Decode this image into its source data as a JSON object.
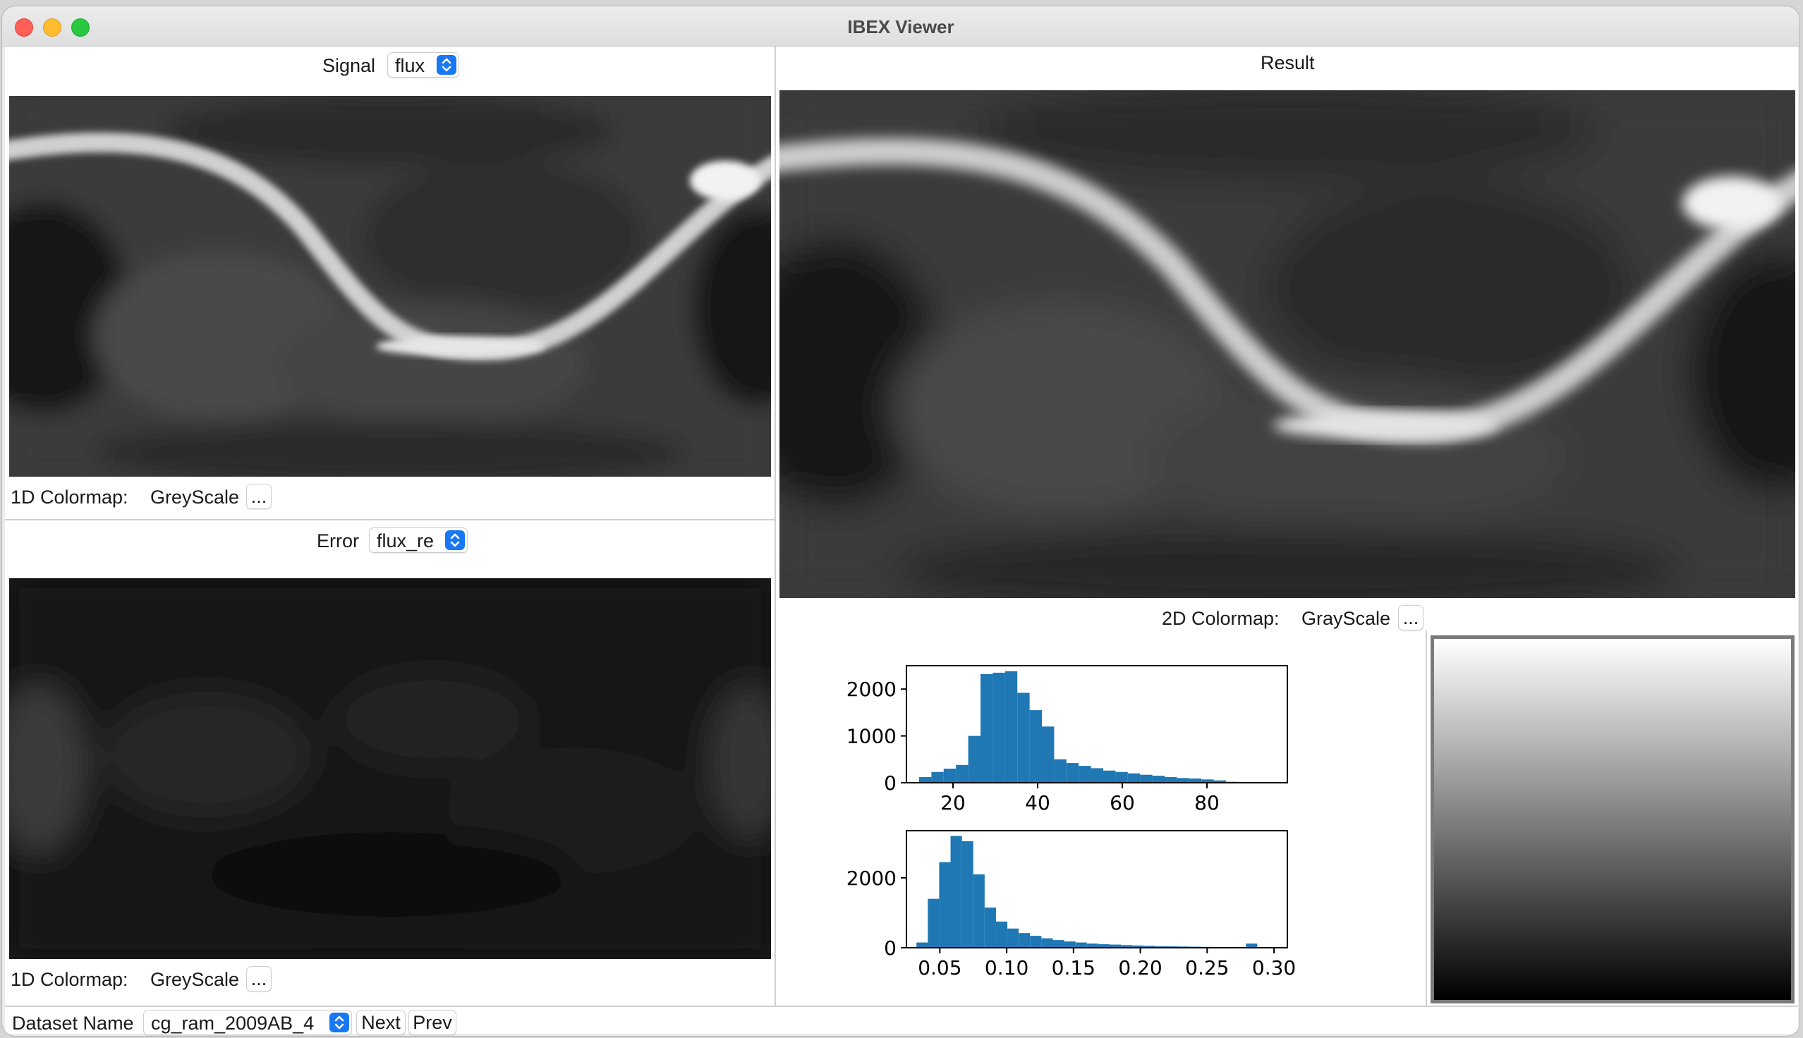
{
  "window": {
    "title": "IBEX Viewer"
  },
  "signal": {
    "label": "Signal",
    "selected": "flux",
    "colormap_label": "1D Colormap:",
    "colormap_value": "GreyScale",
    "more_label": "..."
  },
  "error": {
    "label": "Error",
    "selected": "flux_re",
    "colormap_label": "1D Colormap:",
    "colormap_value": "GreyScale",
    "more_label": "..."
  },
  "result": {
    "label": "Result",
    "colormap_label": "2D Colormap:",
    "colormap_value": "GrayScale",
    "more_label": "..."
  },
  "footer": {
    "dataset_label": "Dataset Name",
    "dataset_value": "cg_ram_2009AB_4",
    "next_label": "Next",
    "prev_label": "Prev"
  },
  "icons": {
    "select_arrows": "chevron-up-down-icon"
  },
  "colors": {
    "accent": "#1877f2",
    "bar": "#1f77b4"
  },
  "chart_data": [
    {
      "type": "bar",
      "title": "",
      "xlabel": "",
      "ylabel": "",
      "xlim": [
        9,
        99
      ],
      "ylim": [
        0,
        2500
      ],
      "xticks": [
        20,
        40,
        60,
        80
      ],
      "yticks": [
        0,
        1000,
        2000
      ],
      "bin_width": 2.9,
      "bin_starts": [
        12.0,
        14.9,
        17.8,
        20.7,
        23.6,
        26.5,
        29.4,
        32.3,
        35.2,
        38.1,
        41.0,
        43.9,
        46.8,
        49.7,
        52.6,
        55.5,
        58.4,
        61.3,
        64.2,
        67.1,
        70.0,
        72.9,
        75.8,
        78.7,
        81.6,
        84.5
      ],
      "values": [
        120,
        230,
        300,
        380,
        1000,
        2320,
        2350,
        2380,
        1920,
        1550,
        1200,
        500,
        420,
        360,
        310,
        260,
        230,
        200,
        170,
        150,
        120,
        100,
        90,
        70,
        50,
        20
      ]
    },
    {
      "type": "bar",
      "title": "",
      "xlabel": "",
      "ylabel": "",
      "xlim": [
        0.025,
        0.31
      ],
      "ylim": [
        0,
        3350
      ],
      "xticks": [
        0.05,
        0.1,
        0.15,
        0.2,
        0.25,
        0.3
      ],
      "xtick_labels": [
        "0.05",
        "0.10",
        "0.15",
        "0.20",
        "0.25",
        "0.30"
      ],
      "yticks": [
        0,
        2000
      ],
      "bin_width": 0.0085,
      "bin_starts": [
        0.0325,
        0.041,
        0.0495,
        0.058,
        0.0665,
        0.075,
        0.0835,
        0.092,
        0.1005,
        0.109,
        0.1175,
        0.126,
        0.1345,
        0.143,
        0.1515,
        0.16,
        0.1685,
        0.177,
        0.1855,
        0.194,
        0.2025,
        0.211,
        0.2195,
        0.228,
        0.2365,
        0.245,
        0.2535,
        0.262,
        0.2705,
        0.279
      ],
      "values": [
        150,
        1400,
        2450,
        3200,
        3050,
        2100,
        1150,
        750,
        550,
        420,
        340,
        270,
        220,
        180,
        150,
        120,
        100,
        90,
        75,
        65,
        55,
        45,
        40,
        35,
        30,
        25,
        20,
        15,
        10,
        120
      ]
    }
  ]
}
